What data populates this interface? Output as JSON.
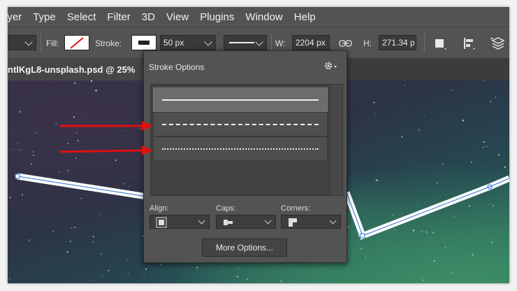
{
  "menubar": {
    "items": [
      "ayer",
      "Type",
      "Select",
      "Filter",
      "3D",
      "View",
      "Plugins",
      "Window",
      "Help"
    ]
  },
  "options": {
    "fill_label": "Fill:",
    "stroke_label": "Stroke:",
    "stroke_width": "50 px",
    "w_label": "W:",
    "w_value": "2204 px",
    "h_label": "H:",
    "h_value": "271.34 p"
  },
  "document": {
    "tab_title": "ntlKgL8-unsplash.psd @ 25%"
  },
  "stroke_options": {
    "title": "Stroke Options",
    "line_styles": [
      {
        "name": "solid",
        "selected": true
      },
      {
        "name": "dashed",
        "selected": false
      },
      {
        "name": "dotted",
        "selected": false
      }
    ],
    "align_label": "Align:",
    "caps_label": "Caps:",
    "corners_label": "Corners:",
    "more_options_label": "More Options..."
  },
  "colors": {
    "ui_panel": "#535353",
    "annotation_arrow": "#e01010",
    "path_stroke": "#ffffff",
    "path_outline": "#2a6fd0"
  },
  "icons": [
    "no-fill-swatch-icon",
    "link-dimensions-icon",
    "gear-icon",
    "align-icon",
    "caps-icon",
    "corners-icon",
    "shape-mode-icon",
    "path-alignment-icon",
    "path-arrangement-icon",
    "chevron-down-icon"
  ]
}
